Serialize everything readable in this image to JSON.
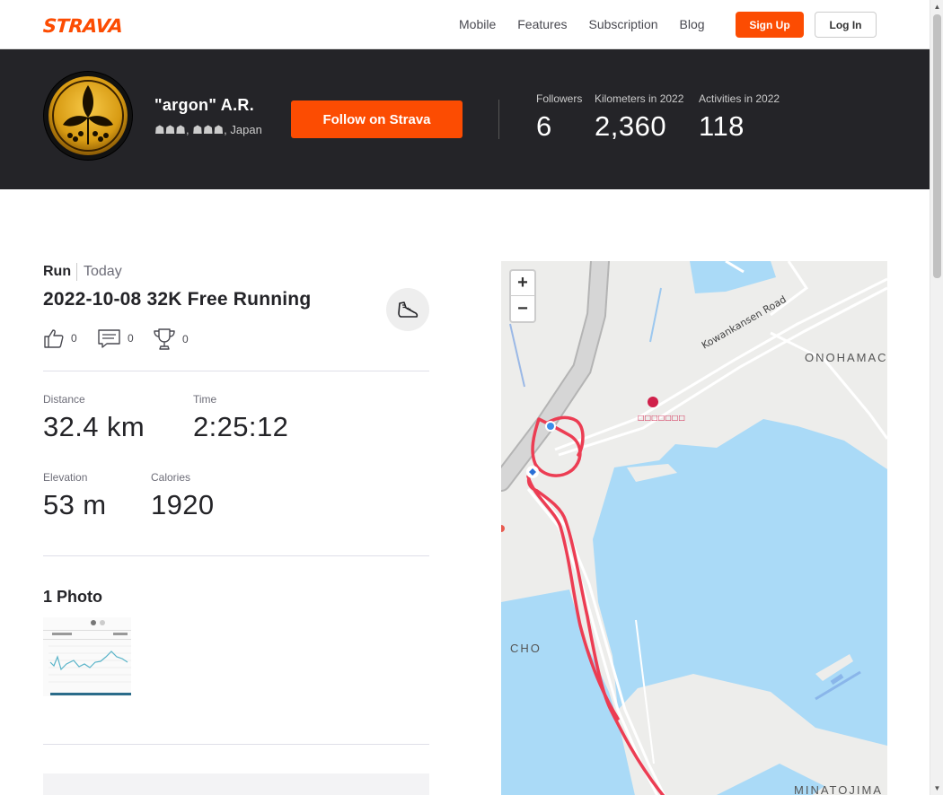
{
  "nav": {
    "logo": "STRAVA",
    "links": [
      "Mobile",
      "Features",
      "Subscription",
      "Blog"
    ],
    "signup": "Sign Up",
    "login": "Log In"
  },
  "athlete": {
    "name": "\"argon\" A.R.",
    "location": "☗☗☗, ☗☗☗, Japan",
    "follow": "Follow on Strava",
    "stats": [
      {
        "label": "Followers",
        "value": "6"
      },
      {
        "label": "Kilometers in 2022",
        "value": "2,360"
      },
      {
        "label": "Activities in 2022",
        "value": "118"
      }
    ]
  },
  "activity": {
    "type": "Run",
    "date": "Today",
    "title": "2022-10-08 32K Free Running",
    "kudos": "0",
    "comments": "0",
    "achievements": "0",
    "stats": {
      "distance_label": "Distance",
      "distance": "32.4 km",
      "time_label": "Time",
      "time": "2:25:12",
      "elevation_label": "Elevation",
      "elevation": "53 m",
      "calories_label": "Calories",
      "calories": "1920"
    },
    "photos_heading": "1 Photo"
  },
  "map": {
    "zoom_in": "+",
    "zoom_out": "−",
    "road_label": "Kowankansen Road",
    "area_labels": [
      "ONOHAMAC",
      "CHO",
      "MINATOJIMA"
    ],
    "poi_label": "□□□□□□□"
  },
  "colors": {
    "brand": "#fc4c02",
    "header_bg": "#242428",
    "water": "#aadaf7",
    "route": "#ec3d53"
  }
}
